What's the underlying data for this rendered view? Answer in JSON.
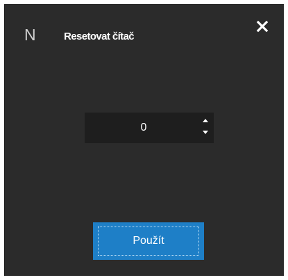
{
  "dialog": {
    "app_logo": "N",
    "title": "Resetovat čítač",
    "close_icon": "close-icon"
  },
  "counter": {
    "value": "0",
    "up_icon": "arrow-up-icon",
    "down_icon": "arrow-down-icon"
  },
  "actions": {
    "apply_label": "Použít"
  },
  "colors": {
    "background": "#2b2b2b",
    "field_background": "#1e1e1e",
    "accent": "#1e7fc7",
    "text": "#ffffff"
  }
}
